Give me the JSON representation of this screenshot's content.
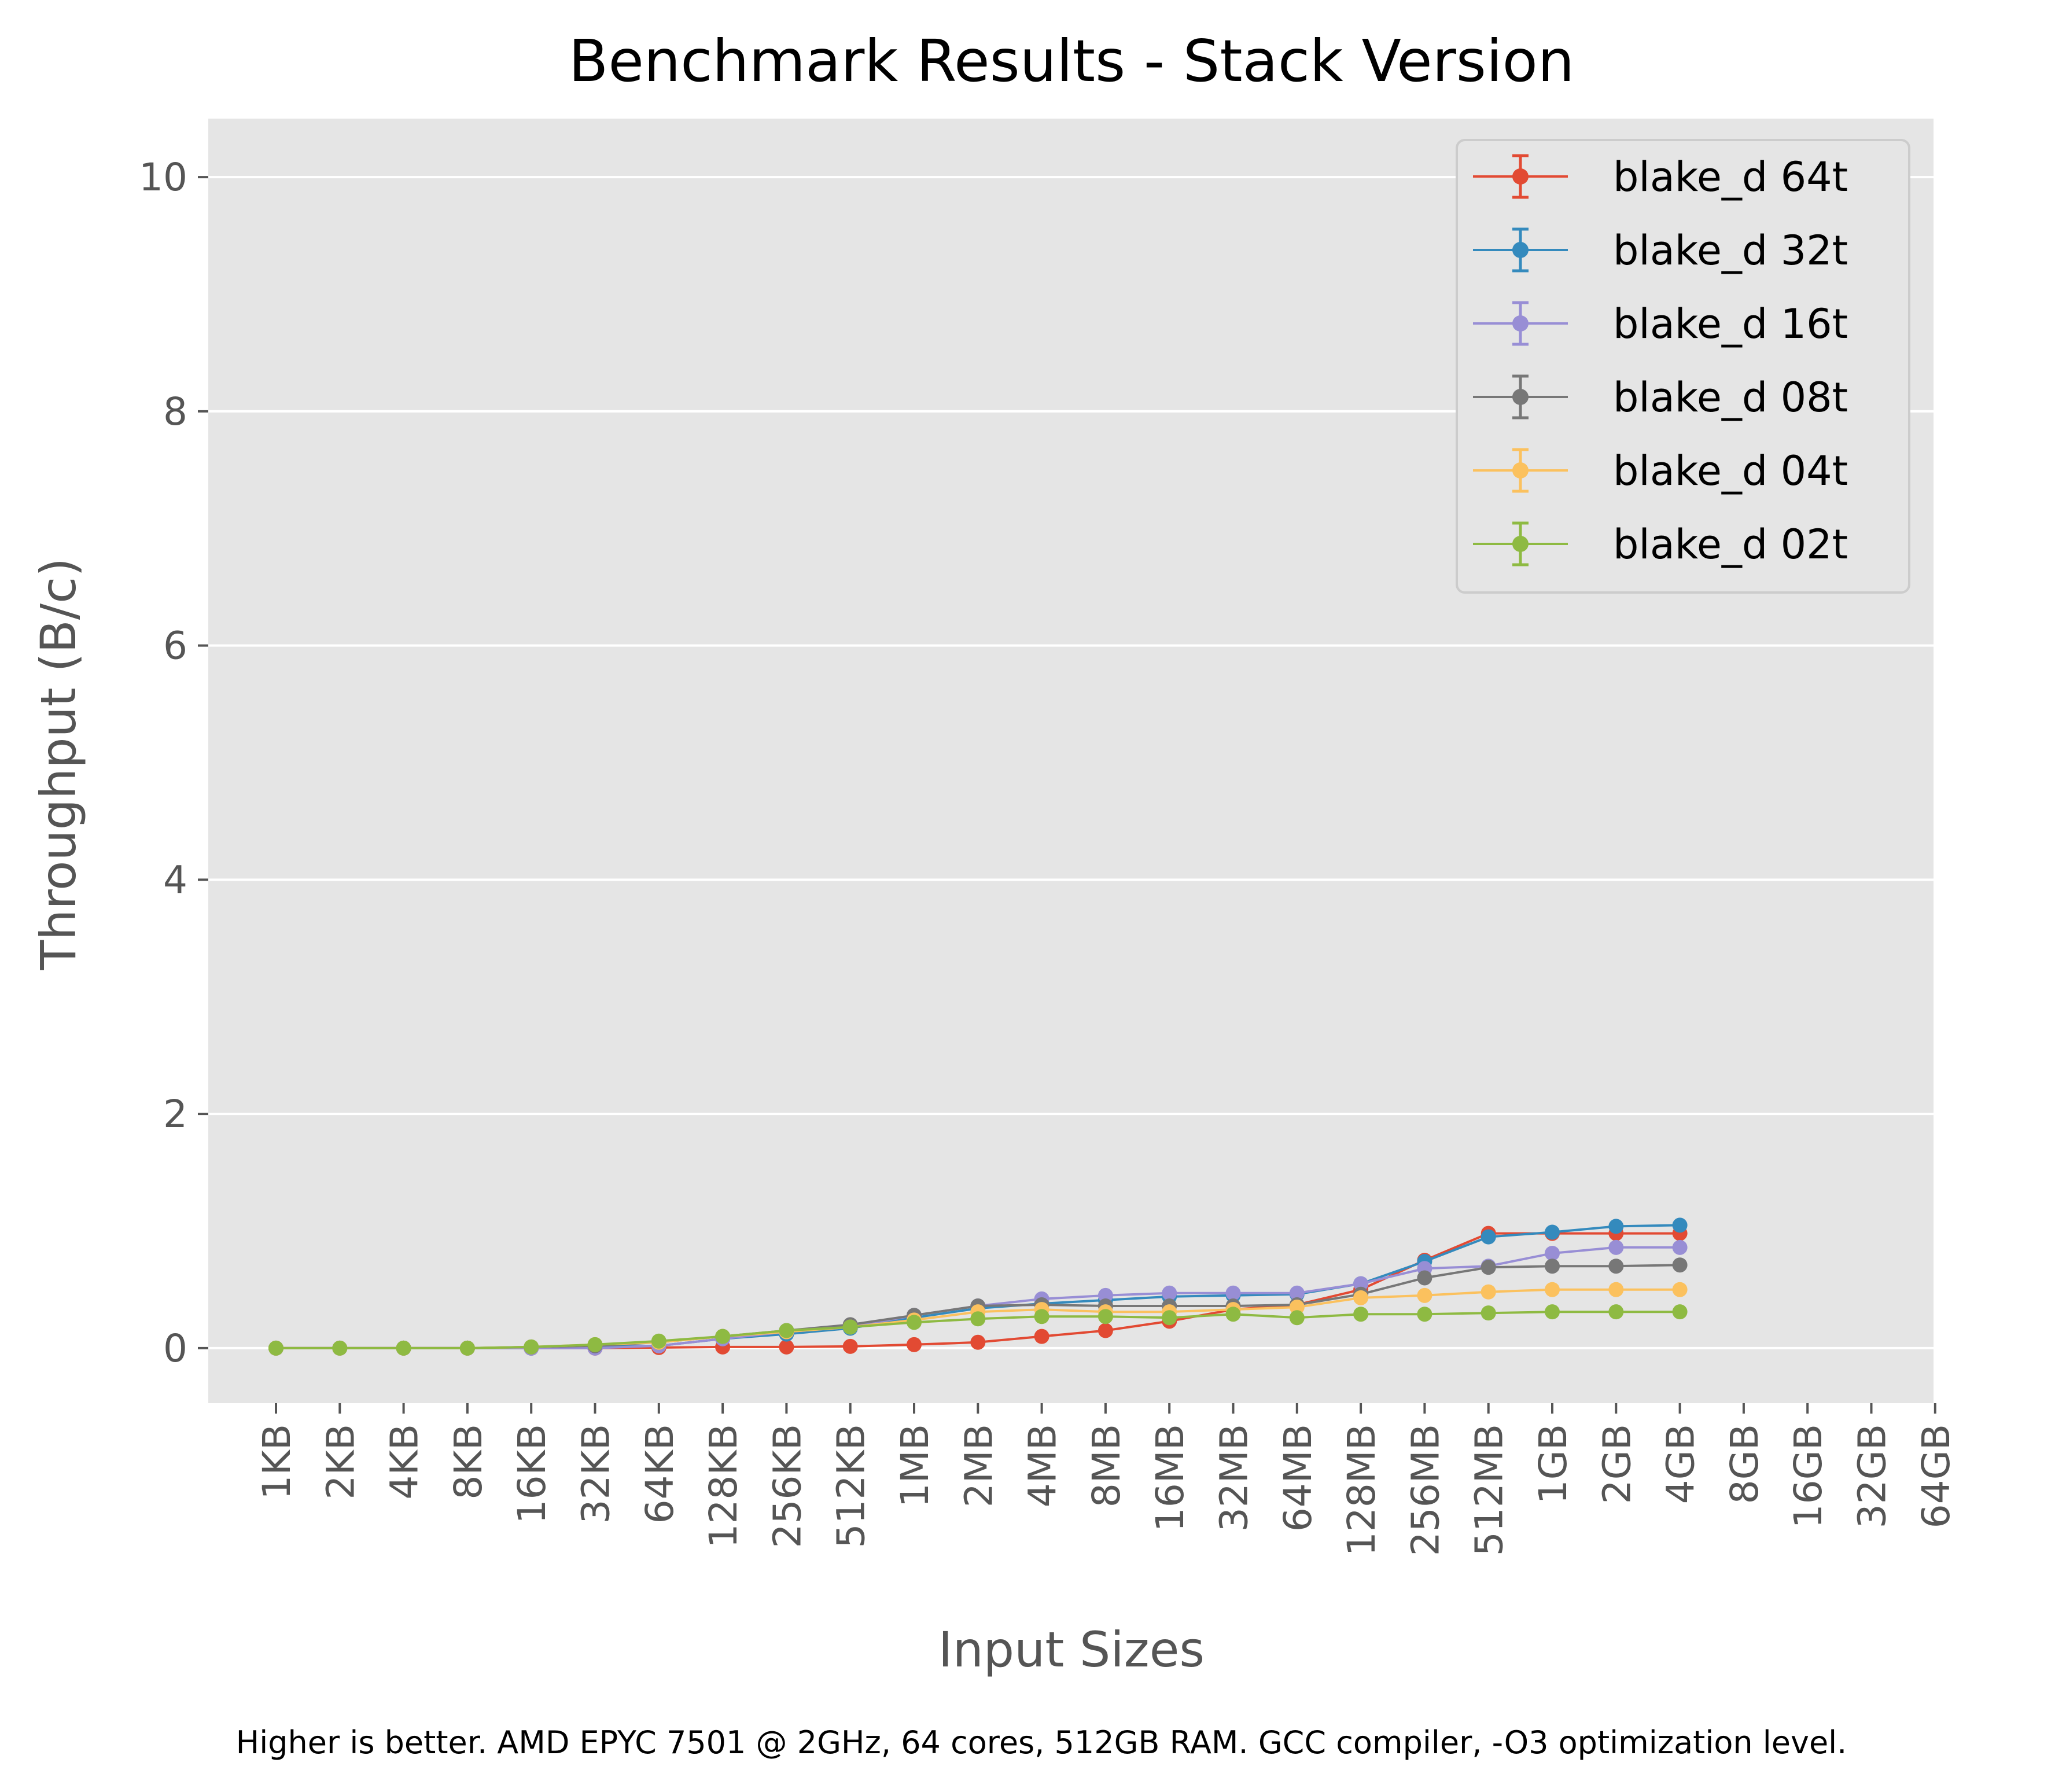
{
  "chart_data": {
    "type": "line",
    "title": "Benchmark Results - Stack Version",
    "xlabel": "Input Sizes",
    "ylabel": "Throughput (B/c)",
    "footnote": "Higher is better. AMD EPYC 7501 @ 2GHz, 64 cores, 512GB RAM. GCC compiler, -O3 optimization level.",
    "categories": [
      "1KB",
      "2KB",
      "4KB",
      "8KB",
      "16KB",
      "32KB",
      "64KB",
      "128KB",
      "256KB",
      "512KB",
      "1MB",
      "2MB",
      "4MB",
      "8MB",
      "16MB",
      "32MB",
      "64MB",
      "128MB",
      "256MB",
      "512MB",
      "1GB",
      "2GB",
      "4GB",
      "8GB",
      "16GB",
      "32GB",
      "64GB"
    ],
    "yticks": [
      0,
      2,
      4,
      6,
      8,
      10
    ],
    "ylim": [
      -0.47,
      10.5
    ],
    "grid": true,
    "legend_position": "top-right",
    "background": "#e5e5e5",
    "series": [
      {
        "name": "blake_d 64t",
        "color": "#e24a33",
        "values": [
          0.0,
          0.0,
          0.0,
          0.0,
          0.0,
          0.0,
          0.005,
          0.01,
          0.01,
          0.015,
          0.03,
          0.05,
          0.1,
          0.15,
          0.23,
          0.33,
          0.37,
          0.5,
          0.75,
          0.98,
          0.98,
          0.98,
          0.98
        ]
      },
      {
        "name": "blake_d 32t",
        "color": "#348abd",
        "values": [
          0.0,
          0.0,
          0.0,
          0.0,
          0.0,
          0.01,
          0.02,
          0.08,
          0.12,
          0.17,
          0.26,
          0.34,
          0.38,
          0.41,
          0.44,
          0.45,
          0.46,
          0.55,
          0.74,
          0.95,
          0.99,
          1.04,
          1.05
        ]
      },
      {
        "name": "blake_d 16t",
        "color": "#988ed5",
        "values": [
          0.0,
          0.0,
          0.0,
          0.0,
          0.0,
          0.0,
          0.02,
          0.08,
          0.14,
          0.18,
          0.28,
          0.36,
          0.42,
          0.45,
          0.47,
          0.47,
          0.47,
          0.55,
          0.68,
          0.7,
          0.81,
          0.86,
          0.86
        ]
      },
      {
        "name": "blake_d 08t",
        "color": "#777777",
        "values": [
          0.0,
          0.0,
          0.0,
          0.0,
          0.01,
          0.02,
          0.05,
          0.1,
          0.15,
          0.2,
          0.28,
          0.36,
          0.37,
          0.36,
          0.36,
          0.36,
          0.37,
          0.46,
          0.6,
          0.69,
          0.7,
          0.7,
          0.71
        ]
      },
      {
        "name": "blake_d 04t",
        "color": "#fbc15e",
        "values": [
          0.0,
          0.0,
          0.0,
          0.0,
          0.01,
          0.03,
          0.05,
          0.1,
          0.14,
          0.18,
          0.24,
          0.31,
          0.33,
          0.31,
          0.31,
          0.33,
          0.35,
          0.43,
          0.45,
          0.48,
          0.5,
          0.5,
          0.5
        ]
      },
      {
        "name": "blake_d 02t",
        "color": "#8eba42",
        "values": [
          0.0,
          0.0,
          0.0,
          0.0,
          0.01,
          0.03,
          0.06,
          0.1,
          0.15,
          0.18,
          0.22,
          0.25,
          0.27,
          0.27,
          0.26,
          0.29,
          0.26,
          0.29,
          0.29,
          0.3,
          0.31,
          0.31,
          0.31
        ]
      }
    ]
  }
}
